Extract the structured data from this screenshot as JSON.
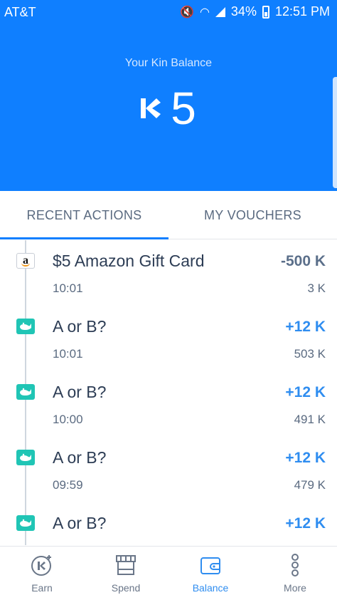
{
  "status_bar": {
    "carrier": "AT&T",
    "battery": "34%",
    "time": "12:51 PM"
  },
  "header": {
    "balance_label": "Your Kin Balance",
    "balance_value": "5",
    "currency_icon": "kin-logo-icon",
    "background_color": "#0f7fff"
  },
  "tabs": [
    {
      "label": "RECENT ACTIONS",
      "active": true
    },
    {
      "label": "MY VOUCHERS",
      "active": false
    }
  ],
  "transactions": [
    {
      "icon": "amazon-icon",
      "title": "$5 Amazon Gift Card",
      "time": "10:01",
      "amount": "-500 K",
      "balance": "3 K",
      "type": "negative"
    },
    {
      "icon": "whale-icon",
      "title": "A or B?",
      "time": "10:01",
      "amount": "+12 K",
      "balance": "503 K",
      "type": "positive"
    },
    {
      "icon": "whale-icon",
      "title": "A or B?",
      "time": "10:00",
      "amount": "+12 K",
      "balance": "491 K",
      "type": "positive"
    },
    {
      "icon": "whale-icon",
      "title": "A or B?",
      "time": "09:59",
      "amount": "+12 K",
      "balance": "479 K",
      "type": "positive"
    },
    {
      "icon": "whale-icon",
      "title": "A or B?",
      "time": "",
      "amount": "+12 K",
      "balance": "",
      "type": "positive"
    }
  ],
  "bottom_nav": [
    {
      "label": "Earn",
      "icon": "earn-kin-icon",
      "active": false
    },
    {
      "label": "Spend",
      "icon": "store-icon",
      "active": false
    },
    {
      "label": "Balance",
      "icon": "wallet-icon",
      "active": true
    },
    {
      "label": "More",
      "icon": "more-dots-icon",
      "active": false
    }
  ],
  "colors": {
    "accent": "#0f7fff",
    "positive_amount": "#2f8df0",
    "negative_amount": "#5b6f8a",
    "whale_badge": "#20c5b5"
  }
}
